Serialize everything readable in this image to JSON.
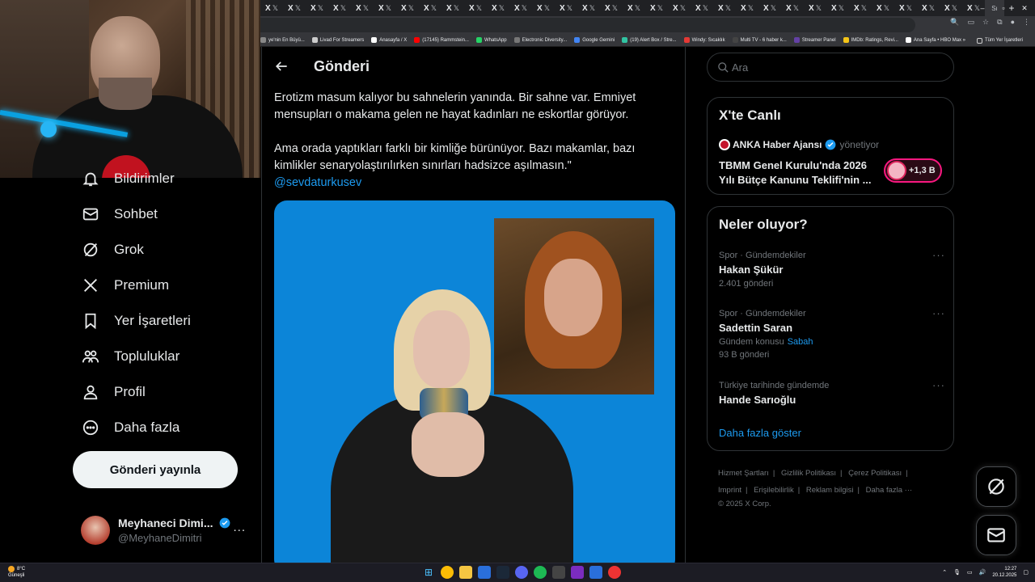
{
  "browser": {
    "tab_labels": [
      "X",
      "X",
      "X",
      "X",
      "X",
      "X",
      "X",
      "X",
      "X",
      "X",
      "X",
      "X",
      "X",
      "X",
      "X",
      "X",
      "X",
      "X",
      "X",
      "X",
      "X",
      "X",
      "X",
      "X",
      "X",
      "X",
      "X",
      "X",
      "X",
      "X",
      "X",
      "X"
    ],
    "tab_suffix": "𝕏",
    "active_tab_label": "Sı",
    "new_tab": "+",
    "bookmarks": [
      {
        "label": "ye'nin En Büyü...",
        "color": "#888"
      },
      {
        "label": "Livad For Streamers",
        "color": "#ccc"
      },
      {
        "label": "Anasayfa / X",
        "color": "#fff"
      },
      {
        "label": "(17145) Rammstein...",
        "color": "#ff0000"
      },
      {
        "label": "WhatsApp",
        "color": "#25d366"
      },
      {
        "label": "Electronic Diversity...",
        "color": "#777"
      },
      {
        "label": "Google Gemini",
        "color": "#4285f4"
      },
      {
        "label": "(19) Alert Box / Stre...",
        "color": "#31c3a2"
      },
      {
        "label": "Windy: Sıcaklık",
        "color": "#e53935"
      },
      {
        "label": "Multi TV - 6 haber k...",
        "color": "#444"
      },
      {
        "label": "Streamer Panel",
        "color": "#6441a5"
      },
      {
        "label": "IMDb: Ratings, Revi...",
        "color": "#f5c518"
      },
      {
        "label": "Ana Sayfa • HBO Max",
        "color": "#fff"
      }
    ],
    "bookmarks_more": "»",
    "bookmarks_folder": "Tüm Yer İşaretleri"
  },
  "sidebar": {
    "items": [
      {
        "label": "Bildirimler",
        "icon": "bell-icon"
      },
      {
        "label": "Sohbet",
        "icon": "mail-icon"
      },
      {
        "label": "Grok",
        "icon": "grok-icon"
      },
      {
        "label": "Premium",
        "icon": "x-logo-icon"
      },
      {
        "label": "Yer İşaretleri",
        "icon": "bookmark-icon"
      },
      {
        "label": "Topluluklar",
        "icon": "communities-icon"
      },
      {
        "label": "Profil",
        "icon": "profile-icon"
      },
      {
        "label": "Daha fazla",
        "icon": "more-circle-icon"
      }
    ],
    "post_button": "Gönderi yayınla",
    "profile": {
      "name": "Meyhaneci Dimi...",
      "handle": "@MeyhaneDimitri",
      "more": "..."
    }
  },
  "main": {
    "header_title": "Gönderi",
    "post_paragraph_1": "Erotizm masum kalıyor bu sahnelerin yanında. Bir sahne var. Emniyet mensupları o makama gelen ne hayat kadınları ne eskortlar görüyor.",
    "post_paragraph_2": "Ama orada yaptıkları farklı bir kimliğe bürünüyor. Bazı makamlar, bazı kimlikler senaryolaştırılırken sınırları hadsizce aşılmasın.\"",
    "mention": "@sevdaturkusev"
  },
  "right": {
    "search_placeholder": "Ara",
    "live": {
      "title": "X'te Canlı",
      "host_name": "ANKA Haber Ajansı",
      "host_role": "yönetiyor",
      "stream_title": "TBMM Genel Kurulu'nda 2026 Yılı Bütçe Kanunu Teklifi'nin ...",
      "listener_count": "+1,3 B"
    },
    "trends_title": "Neler oluyor?",
    "trends": [
      {
        "meta": "Spor · Gündemdekiler",
        "name": "Hakan Şükür",
        "count": "2.401 gönderi",
        "topic": "",
        "topic_link": ""
      },
      {
        "meta": "Spor · Gündemdekiler",
        "name": "Sadettin Saran",
        "count": "93 B gönderi",
        "topic": "Gündem konusu",
        "topic_link": "Sabah"
      },
      {
        "meta": "Türkiye tarihinde gündemde",
        "name": "Hande Sarıoğlu",
        "count": "",
        "topic": "",
        "topic_link": ""
      }
    ],
    "trend_more": "···",
    "show_more": "Daha fazla göster",
    "footer": {
      "links_row1": [
        "Hizmet Şartları",
        "Gizlilik Politikası",
        "Çerez Politikası"
      ],
      "links_row2": [
        "Imprint",
        "Erişilebilirlik",
        "Reklam bilgisi",
        "Daha fazla ···"
      ],
      "copyright": "© 2025 X Corp."
    }
  },
  "taskbar": {
    "weather_temp": "8°C",
    "weather_desc": "Güneşli",
    "time": "12:27",
    "date": "20.12.2025"
  },
  "colors": {
    "accent": "#1d9bf0",
    "live_pink": "#f91880",
    "text": "#e7e9ea",
    "muted": "#71767b",
    "border": "#2f3336"
  }
}
